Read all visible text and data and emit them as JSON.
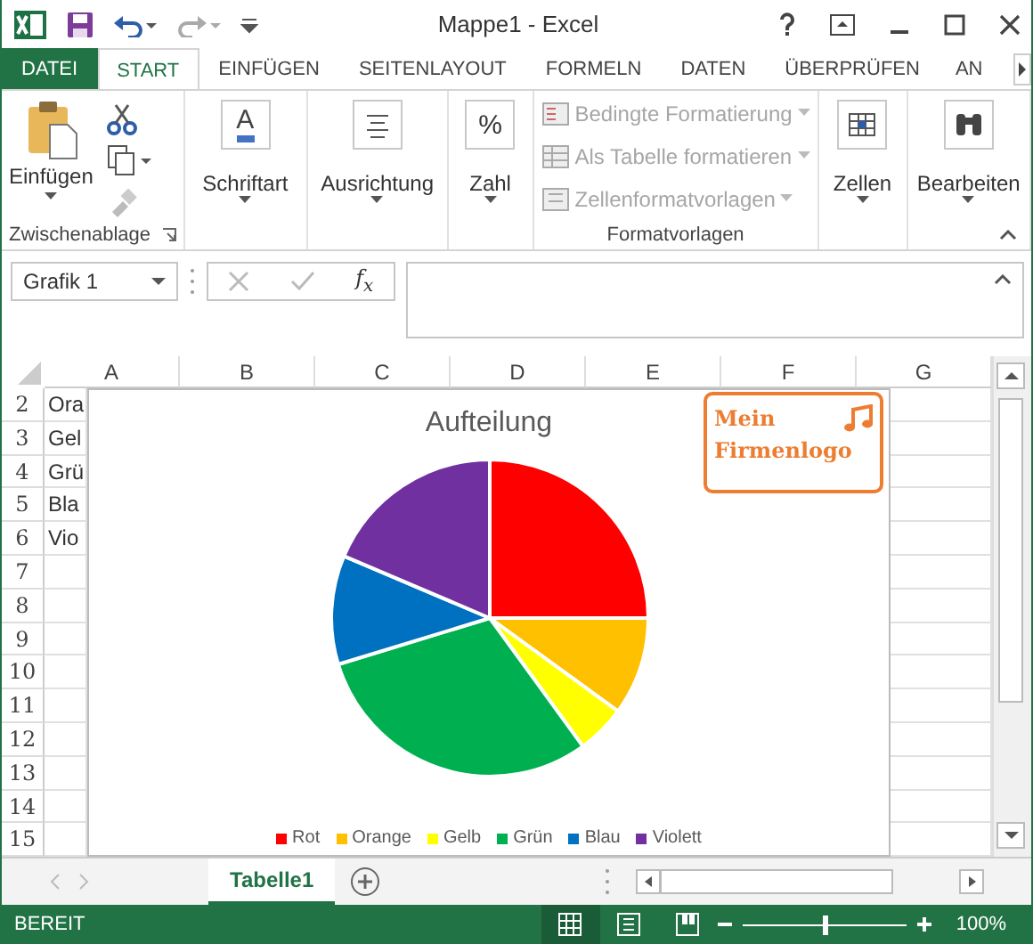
{
  "window": {
    "title": "Mappe1 - Excel"
  },
  "tabs": [
    {
      "label": "DATEI",
      "kind": "file",
      "selected": false
    },
    {
      "label": "START",
      "kind": "tab",
      "selected": true
    },
    {
      "label": "EINFÜGEN",
      "kind": "tab",
      "selected": false
    },
    {
      "label": "SEITENLAYOUT",
      "kind": "tab",
      "selected": false
    },
    {
      "label": "FORMELN",
      "kind": "tab",
      "selected": false
    },
    {
      "label": "DATEN",
      "kind": "tab",
      "selected": false
    },
    {
      "label": "ÜBERPRÜFEN",
      "kind": "tab",
      "selected": false
    },
    {
      "label": "AN",
      "kind": "tab",
      "selected": false
    }
  ],
  "ribbon": {
    "clipboard": {
      "paste": "Einfügen",
      "group": "Zwischenablage"
    },
    "buttons": [
      {
        "label": "Schriftart",
        "glyph": "A",
        "kind": "font"
      },
      {
        "label": "Ausrichtung",
        "kind": "align"
      },
      {
        "label": "Zahl",
        "glyph": "%",
        "kind": "number"
      }
    ],
    "styles": {
      "group": "Formatvorlagen",
      "items": [
        {
          "label": "Bedingte Formatierung",
          "disabled": true
        },
        {
          "label": "Als Tabelle formatieren",
          "disabled": true
        },
        {
          "label": "Zellenformatvorlagen",
          "disabled": true
        }
      ]
    },
    "buttons_2": [
      {
        "label": "Zellen",
        "kind": "cells"
      },
      {
        "label": "Bearbeiten",
        "kind": "edit"
      }
    ]
  },
  "formula_bar": {
    "name_box": "Grafik 1",
    "function_label": "f$_{x}$"
  },
  "columns": [
    "A",
    "B",
    "C",
    "D",
    "E",
    "F",
    "G"
  ],
  "rows": [
    {
      "number": "2",
      "cell_a": "Ora"
    },
    {
      "number": "3",
      "cell_a": "Gel"
    },
    {
      "number": "4",
      "cell_a": "Grü"
    },
    {
      "number": "5",
      "cell_a": "Bla"
    },
    {
      "number": "6",
      "cell_a": "Vio"
    },
    {
      "number": "7"
    },
    {
      "number": "8"
    },
    {
      "number": "9"
    },
    {
      "number": "10"
    },
    {
      "number": "11"
    },
    {
      "number": "12"
    },
    {
      "number": "13"
    },
    {
      "number": "14"
    },
    {
      "number": "15"
    }
  ],
  "chart": {
    "title": "Aufteilung",
    "legend": [
      {
        "label": "Rot",
        "color": "#ff0000"
      },
      {
        "label": "Orange",
        "color": "#ffc000"
      },
      {
        "label": "Gelb",
        "color": "#ffff00"
      },
      {
        "label": "Grün",
        "color": "#00b050"
      },
      {
        "label": "Blau",
        "color": "#0070c0"
      },
      {
        "label": "Violett",
        "color": "#7030a0"
      }
    ]
  },
  "logo": {
    "line_1": "Mein",
    "line_2": "Firmenlogo"
  },
  "sheet_tabs": [
    {
      "label": "Tabelle1",
      "selected": true
    }
  ],
  "status_bar": {
    "status": "BEREIT",
    "views": [
      {
        "kind": "normal",
        "selected": true
      },
      {
        "kind": "layout",
        "selected": false
      },
      {
        "kind": "pagebreak",
        "selected": false
      }
    ],
    "zoom": {
      "level": 0.5
    },
    "zoom_reading": "100%"
  }
}
